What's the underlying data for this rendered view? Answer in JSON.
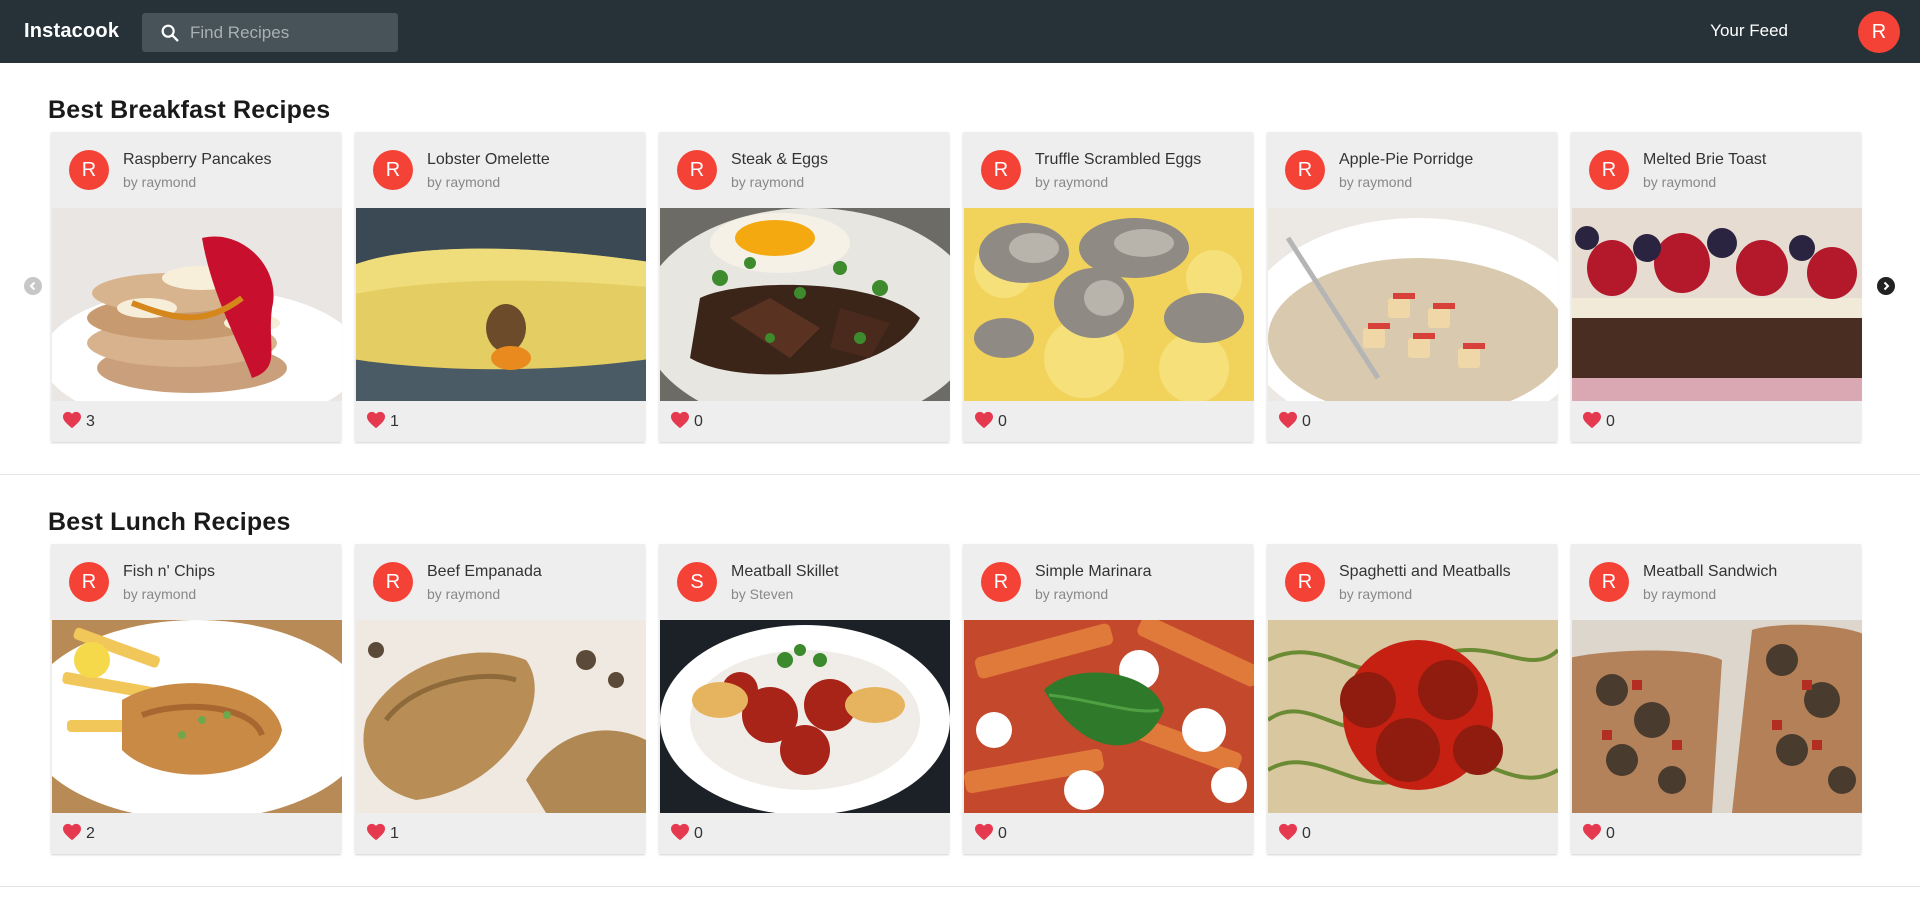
{
  "navbar": {
    "brand": "Instacook",
    "search_placeholder": "Find Recipes",
    "feed_link": "Your Feed",
    "user_initial": "R"
  },
  "colors": {
    "navbar": "#263238",
    "avatar": "#f44336",
    "heart": "#e53950",
    "card_bg": "#eeeeee"
  },
  "icons": {
    "search": "search-icon",
    "heart": "heart-icon",
    "prev": "chevron-left-icon",
    "next": "chevron-right-icon"
  },
  "sections": [
    {
      "title": "Best Breakfast Recipes",
      "recipes": [
        {
          "initial": "R",
          "name": "Raspberry Pancakes",
          "author": "by raymond",
          "likes": "3"
        },
        {
          "initial": "R",
          "name": "Lobster Omelette",
          "author": "by raymond",
          "likes": "1"
        },
        {
          "initial": "R",
          "name": "Steak & Eggs",
          "author": "by raymond",
          "likes": "0"
        },
        {
          "initial": "R",
          "name": "Truffle Scrambled Eggs",
          "author": "by raymond",
          "likes": "0"
        },
        {
          "initial": "R",
          "name": "Apple-Pie Porridge",
          "author": "by raymond",
          "likes": "0"
        },
        {
          "initial": "R",
          "name": "Melted Brie Toast",
          "author": "by raymond",
          "likes": "0"
        }
      ]
    },
    {
      "title": "Best Lunch Recipes",
      "recipes": [
        {
          "initial": "R",
          "name": "Fish n' Chips",
          "author": "by raymond",
          "likes": "2"
        },
        {
          "initial": "R",
          "name": "Beef Empanada",
          "author": "by raymond",
          "likes": "1"
        },
        {
          "initial": "S",
          "name": "Meatball Skillet",
          "author": "by Steven",
          "likes": "0"
        },
        {
          "initial": "R",
          "name": "Simple Marinara",
          "author": "by raymond",
          "likes": "0"
        },
        {
          "initial": "R",
          "name": "Spaghetti and Meatballs",
          "author": "by raymond",
          "likes": "0"
        },
        {
          "initial": "R",
          "name": "Meatball Sandwich",
          "author": "by raymond",
          "likes": "0"
        }
      ]
    }
  ]
}
